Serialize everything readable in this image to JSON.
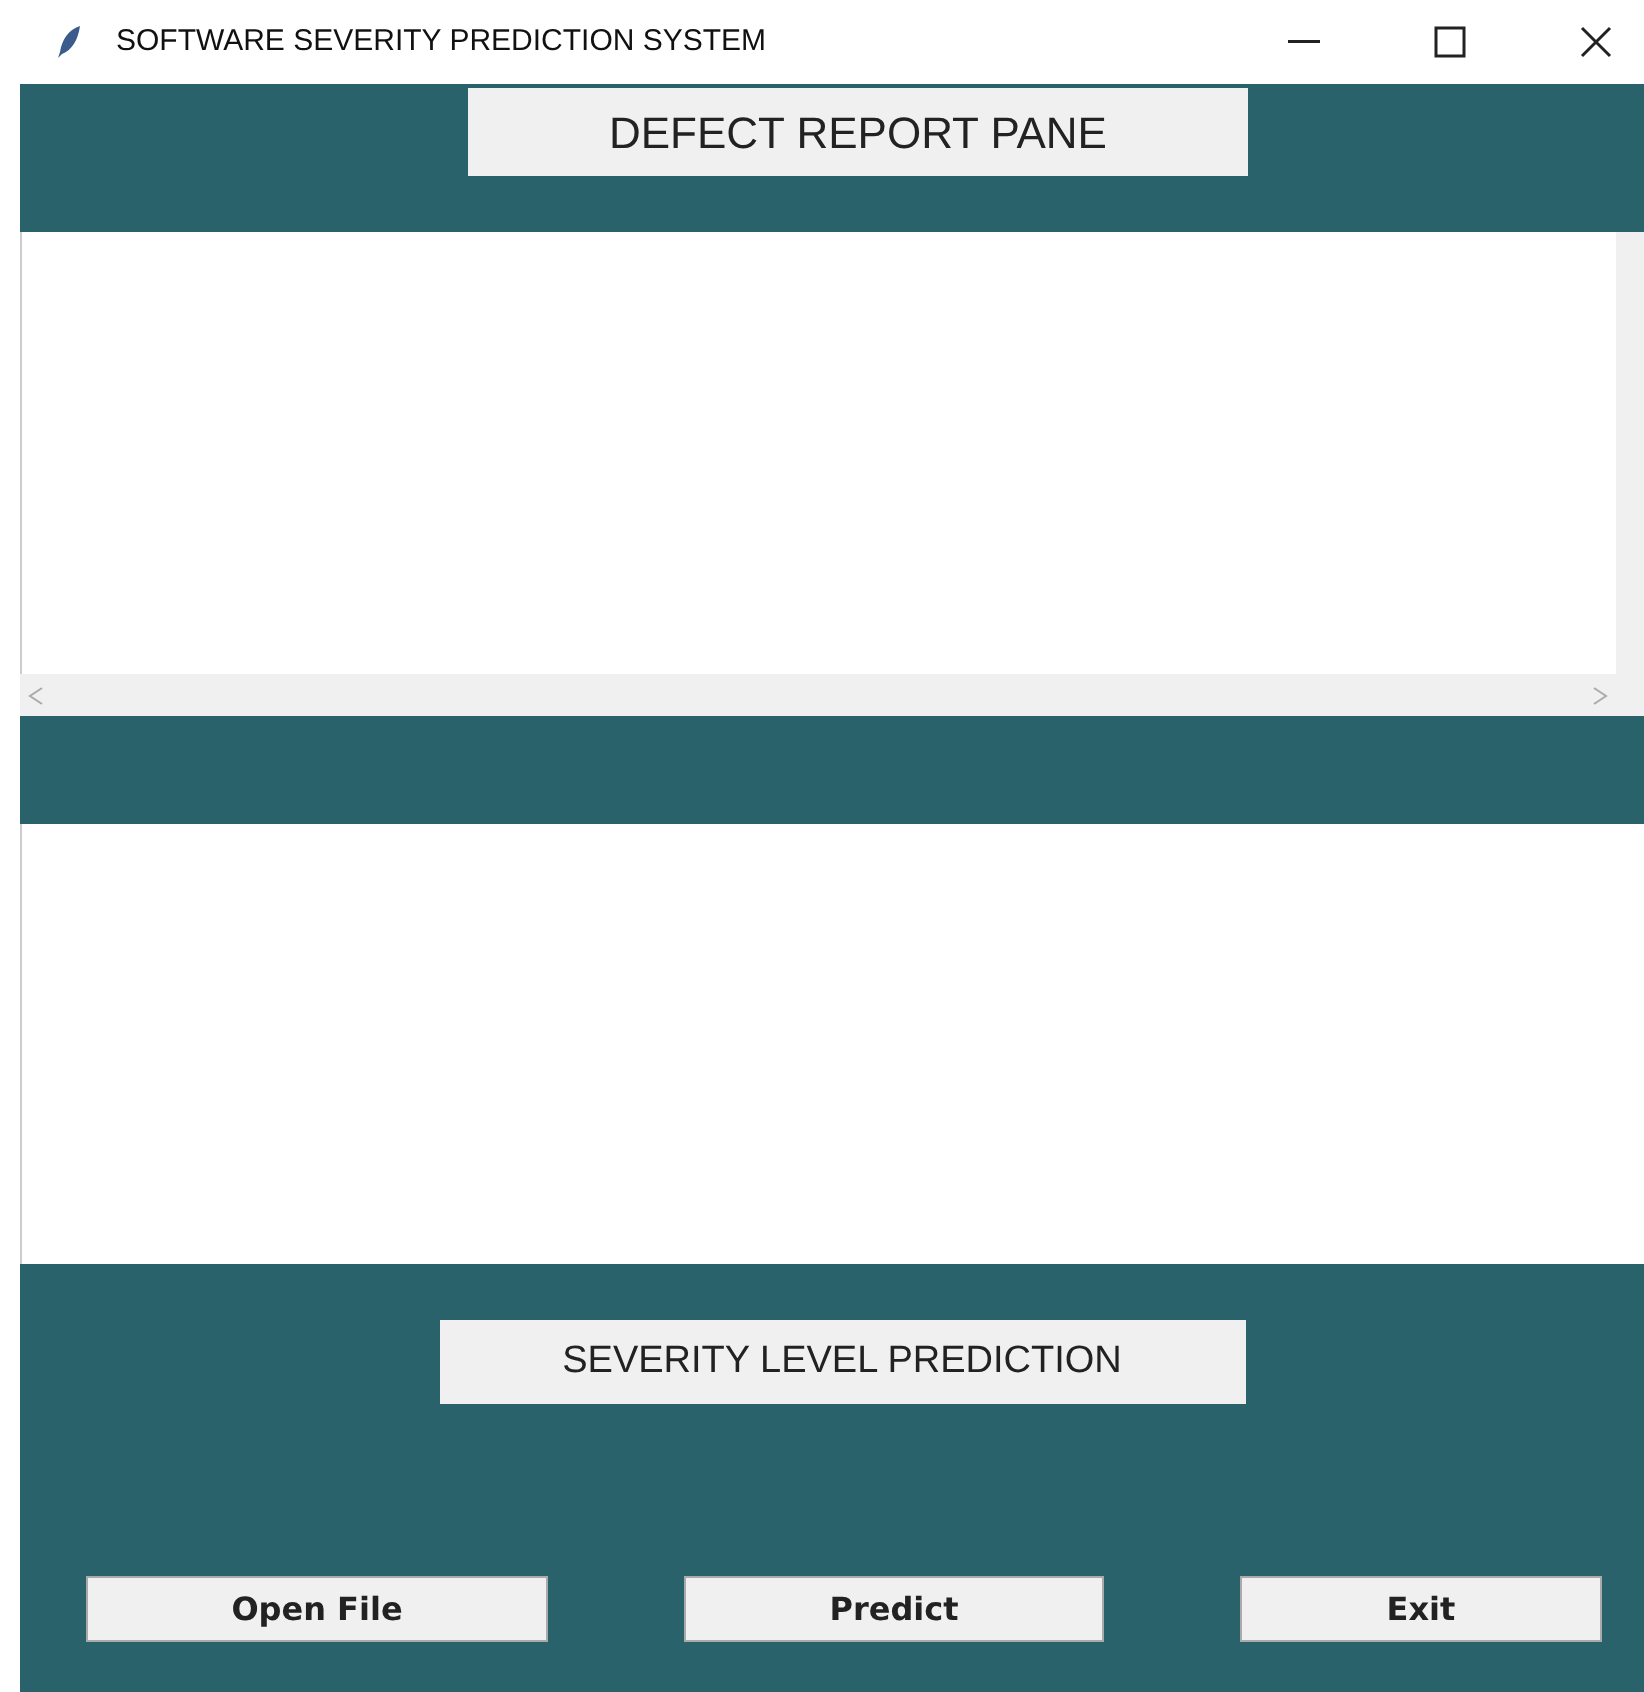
{
  "window": {
    "title": "SOFTWARE SEVERITY PREDICTION SYSTEM"
  },
  "report_pane": {
    "label": "DEFECT REPORT PANE"
  },
  "prediction": {
    "label": "SEVERITY LEVEL PREDICTION"
  },
  "buttons": [
    "Open File",
    "Predict",
    "Exit"
  ]
}
